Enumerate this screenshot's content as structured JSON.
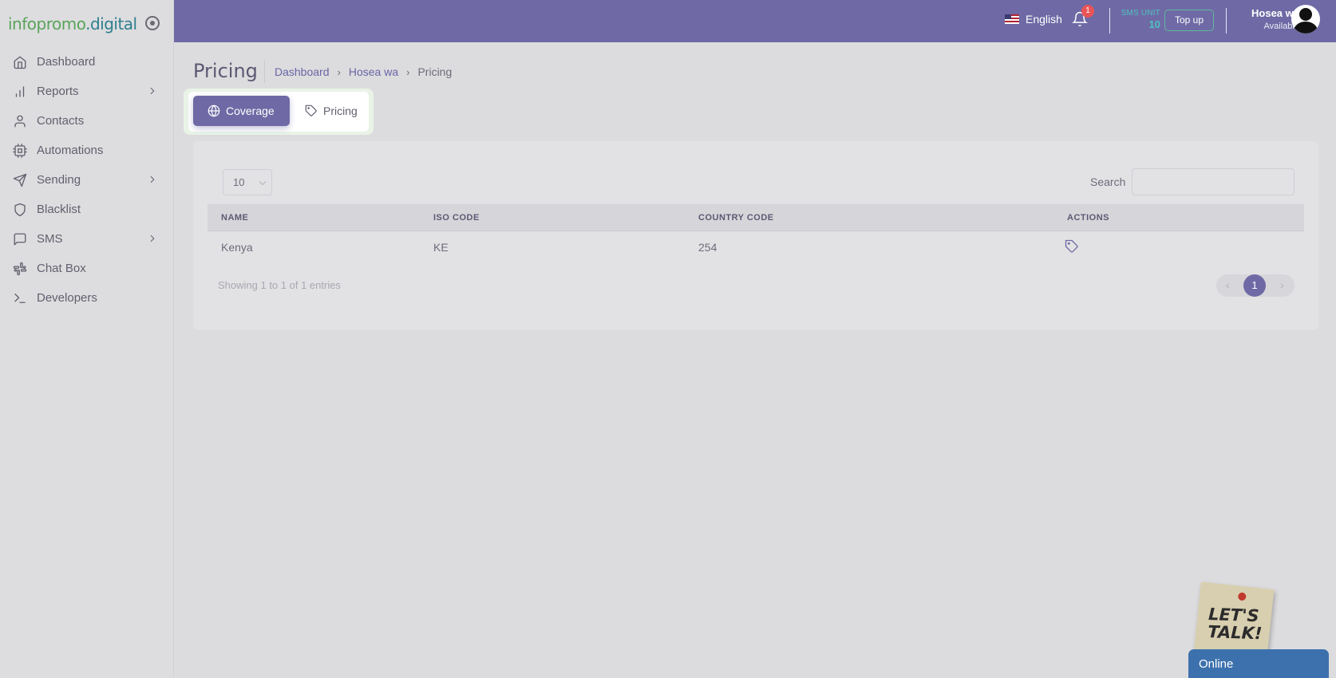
{
  "brand": {
    "part1": "infopromo",
    "part2": ".digital"
  },
  "sidebar": {
    "items": [
      {
        "label": "Dashboard",
        "icon": "home-icon"
      },
      {
        "label": "Reports",
        "icon": "bar-chart-icon"
      },
      {
        "label": "Contacts",
        "icon": "user-icon"
      },
      {
        "label": "Automations",
        "icon": "cpu-icon"
      },
      {
        "label": "Sending",
        "icon": "send-icon"
      },
      {
        "label": "Blacklist",
        "icon": "shield-icon"
      },
      {
        "label": "SMS",
        "icon": "message-square-icon"
      },
      {
        "label": "Chat Box",
        "icon": "slack-icon"
      },
      {
        "label": "Developers",
        "icon": "terminal-icon"
      }
    ]
  },
  "header": {
    "language": "English",
    "notification_count": "1",
    "sms_unit_label": "SMS UNIT",
    "sms_unit_value": "10",
    "topup_label": "Top up",
    "user_name": "Hosea wa",
    "user_status": "Available"
  },
  "page": {
    "title": "Pricing",
    "breadcrumb": {
      "home": "Dashboard",
      "user": "Hosea wa",
      "current": "Pricing"
    }
  },
  "tabs": {
    "coverage": "Coverage",
    "pricing": "Pricing"
  },
  "table": {
    "length_value": "10",
    "search_label": "Search",
    "search_value": "",
    "headers": {
      "name": "NAME",
      "iso": "ISO CODE",
      "country": "COUNTRY CODE",
      "actions": "ACTIONS"
    },
    "rows": [
      {
        "name": "Kenya",
        "iso": "KE",
        "country": "254"
      }
    ],
    "info": "Showing 1 to 1 of 1 entries",
    "pager": {
      "prev": "‹",
      "current": "1",
      "next": "›"
    }
  },
  "chat": {
    "lets_talk_line1": "LET'S",
    "lets_talk_line2": "TALK!",
    "status": "Online"
  },
  "colors": {
    "primary": "#6f6aa5",
    "accent_teal": "#4fc2c2",
    "chat_blue": "#3d71ad"
  }
}
